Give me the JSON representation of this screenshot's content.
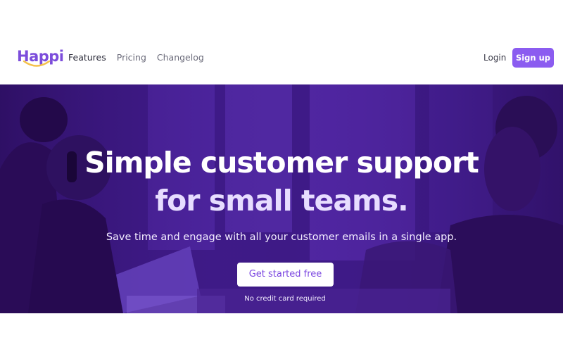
{
  "brand": {
    "name": "Happi",
    "accent": "#8b5cf0",
    "logo_color": "#7c4ddb",
    "smile_color": "#f4c14a"
  },
  "nav": {
    "links": [
      {
        "label": "Features",
        "active": true
      },
      {
        "label": "Pricing",
        "active": false
      },
      {
        "label": "Changelog",
        "active": false
      }
    ],
    "login_label": "Login",
    "signup_label": "Sign up"
  },
  "hero": {
    "overlay_color": "#3e1a86",
    "headline_line1": "Simple customer support",
    "headline_line2": "for small teams.",
    "subheadline": "Save time and engage with all your customer emails in a single app.",
    "cta_label": "Get started free",
    "cta_note": "No credit card required"
  }
}
